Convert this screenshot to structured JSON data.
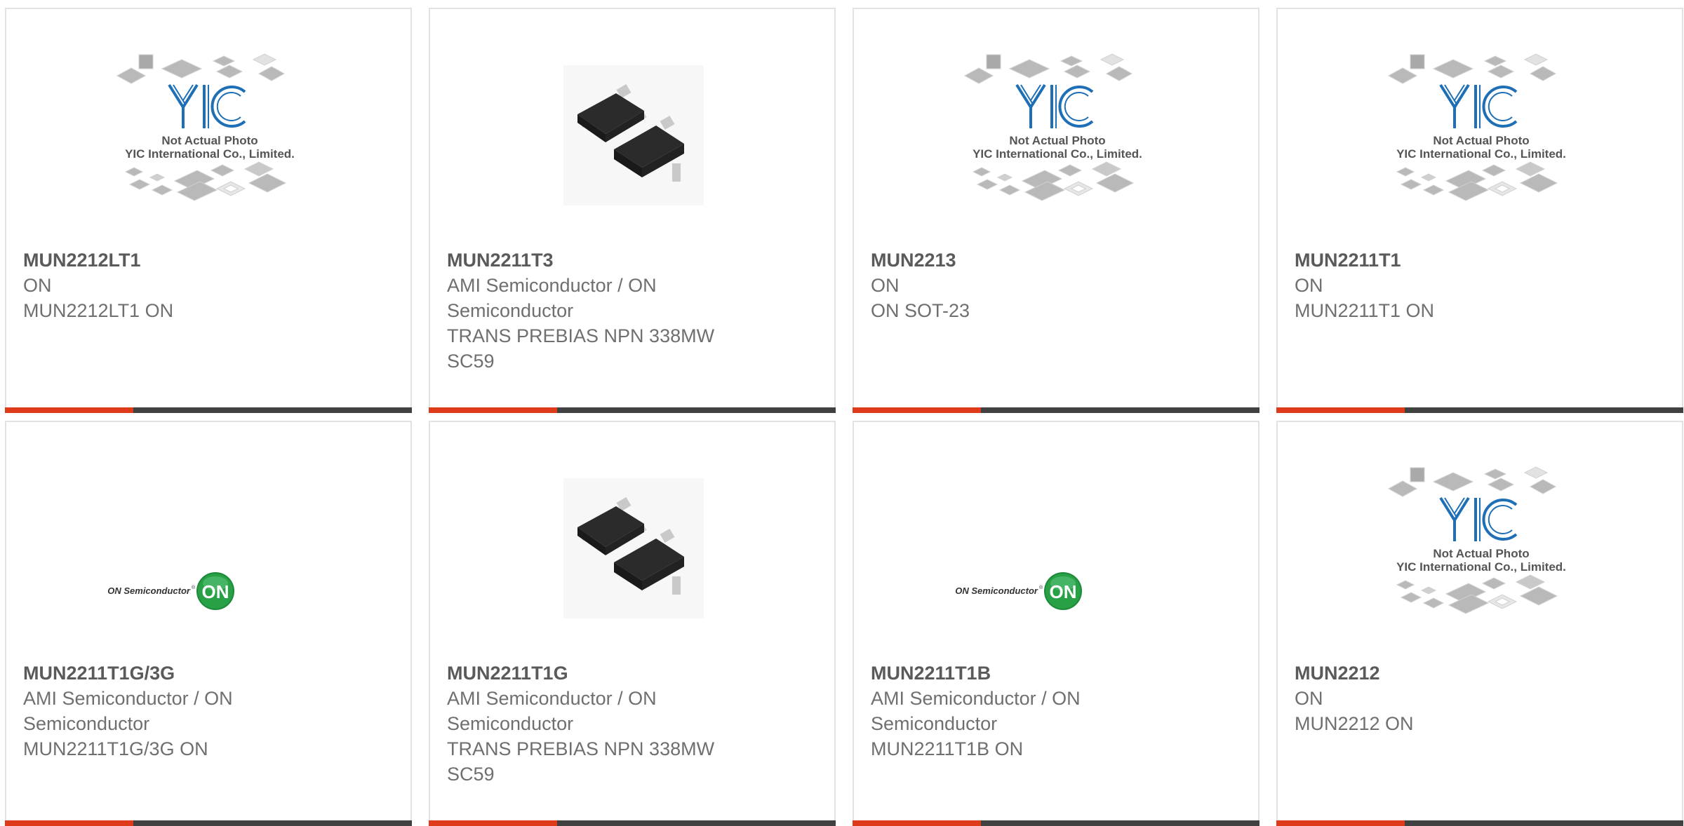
{
  "placeholder": {
    "line1": "Not Actual Photo",
    "line2": "YIC International Co., Limited.",
    "logo_text": "YIC"
  },
  "on_logo": {
    "wordmark": "ON Semiconductor",
    "badge": "ON"
  },
  "colors": {
    "accent": "#dd3b1a",
    "bar": "#414141",
    "on_green": "#1d8a3a",
    "yic_blue": "#1e6fb5"
  },
  "products": [
    {
      "part": "MUN2212LT1",
      "manufacturer": "ON",
      "description": "MUN2212LT1 ON",
      "image": "placeholder"
    },
    {
      "part": "MUN2211T3",
      "manufacturer": "AMI Semiconductor / ON Semiconductor",
      "description": "TRANS PREBIAS NPN 338MW SC59",
      "image": "sot23-photo"
    },
    {
      "part": "MUN2213",
      "manufacturer": "ON",
      "description": "ON SOT-23",
      "image": "placeholder"
    },
    {
      "part": "MUN2211T1",
      "manufacturer": "ON",
      "description": "MUN2211T1 ON",
      "image": "placeholder"
    },
    {
      "part": "MUN2211T1G/3G",
      "manufacturer": "AMI Semiconductor / ON Semiconductor",
      "description": "MUN2211T1G/3G ON",
      "image": "on-logo"
    },
    {
      "part": "MUN2211T1G",
      "manufacturer": "AMI Semiconductor / ON Semiconductor",
      "description": "TRANS PREBIAS NPN 338MW SC59",
      "image": "sot23-photo"
    },
    {
      "part": "MUN2211T1B",
      "manufacturer": "AMI Semiconductor / ON Semiconductor",
      "description": "MUN2211T1B ON",
      "image": "on-logo"
    },
    {
      "part": "MUN2212",
      "manufacturer": "ON",
      "description": "MUN2212 ON",
      "image": "placeholder"
    }
  ]
}
